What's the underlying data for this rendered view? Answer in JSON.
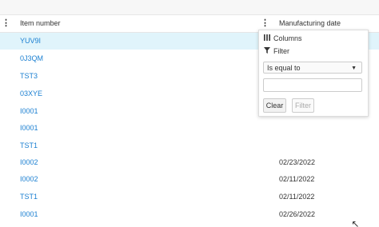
{
  "header": {
    "col1": "Item number",
    "col2": "Manufacturing date"
  },
  "rows": [
    {
      "id": "YUV9I",
      "date": ""
    },
    {
      "id": "0J3QM",
      "date": ""
    },
    {
      "id": "TST3",
      "date": ""
    },
    {
      "id": "03XYE",
      "date": ""
    },
    {
      "id": "I0001",
      "date": ""
    },
    {
      "id": "I0001",
      "date": ""
    },
    {
      "id": "TST1",
      "date": ""
    },
    {
      "id": "I0002",
      "date": "02/23/2022"
    },
    {
      "id": "I0002",
      "date": "02/11/2022"
    },
    {
      "id": "TST1",
      "date": "02/11/2022"
    },
    {
      "id": "I0001",
      "date": "02/26/2022"
    }
  ],
  "menu": {
    "columns_label": "Columns",
    "filter_label": "Filter",
    "operator": "Is equal to",
    "value": "",
    "clear_label": "Clear",
    "filter_button_label": "Filter"
  },
  "colors": {
    "link": "#1a7fd1",
    "selected_row": "#e0f4fb"
  }
}
